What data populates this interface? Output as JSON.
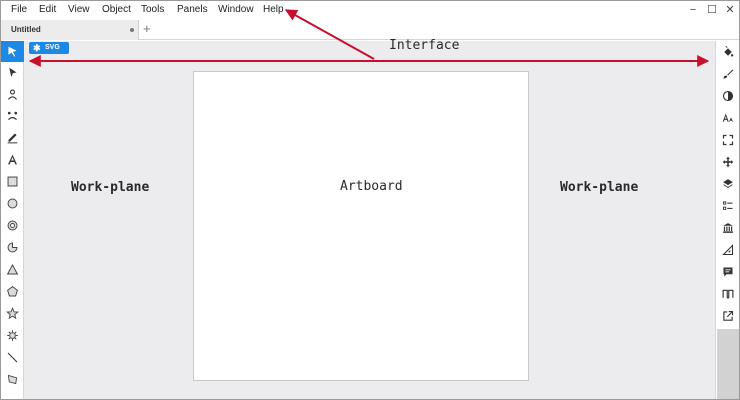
{
  "menu": {
    "items": [
      {
        "label": "File"
      },
      {
        "label": "Edit"
      },
      {
        "label": "View"
      },
      {
        "label": "Object"
      },
      {
        "label": "Tools"
      },
      {
        "label": "Panels"
      },
      {
        "label": "Window"
      },
      {
        "label": "Help"
      }
    ]
  },
  "window_controls": {
    "minimize": "−",
    "maximize": "☐",
    "close": "✕"
  },
  "tabs": {
    "document": "Untitled",
    "new_tab": "+"
  },
  "canvas": {
    "badge": "SVG",
    "badge_icon": "gear-icon"
  },
  "annotations": {
    "interface": "Interface",
    "workplane_left": "Work-plane",
    "artboard": "Artboard",
    "workplane_right": "Work-plane",
    "arrow_color": "#c8102e"
  },
  "left_tools": [
    {
      "icon": "select-arrow-icon",
      "active": true
    },
    {
      "icon": "node-arrow-icon",
      "active": false
    },
    {
      "icon": "person-icon",
      "active": false
    },
    {
      "icon": "face-icon",
      "active": false
    },
    {
      "icon": "pencil-icon",
      "active": false
    },
    {
      "icon": "text-icon",
      "active": false
    },
    {
      "icon": "rectangle-icon",
      "active": false
    },
    {
      "icon": "ellipse-icon",
      "active": false
    },
    {
      "icon": "ring-icon",
      "active": false
    },
    {
      "icon": "pie-icon",
      "active": false
    },
    {
      "icon": "triangle-icon",
      "active": false
    },
    {
      "icon": "pentagon-icon",
      "active": false
    },
    {
      "icon": "star-icon",
      "active": false
    },
    {
      "icon": "cog-shape-icon",
      "active": false
    },
    {
      "icon": "line-icon",
      "active": false
    },
    {
      "icon": "path-icon",
      "active": false
    }
  ],
  "right_panels": [
    {
      "icon": "paint-bucket-icon"
    },
    {
      "icon": "brush-icon"
    },
    {
      "icon": "contrast-icon"
    },
    {
      "icon": "font-size-icon"
    },
    {
      "icon": "fit-screen-icon"
    },
    {
      "icon": "move-icon"
    },
    {
      "icon": "layers-icon"
    },
    {
      "icon": "list-icon"
    },
    {
      "icon": "library-icon"
    },
    {
      "icon": "ruler-icon"
    },
    {
      "icon": "comment-icon"
    },
    {
      "icon": "pulse-icon"
    },
    {
      "icon": "export-icon"
    }
  ],
  "colors": {
    "accent": "#1e88e5",
    "workplane": "#ececef",
    "artboard": "#ffffff",
    "arrow": "#c8102e"
  }
}
